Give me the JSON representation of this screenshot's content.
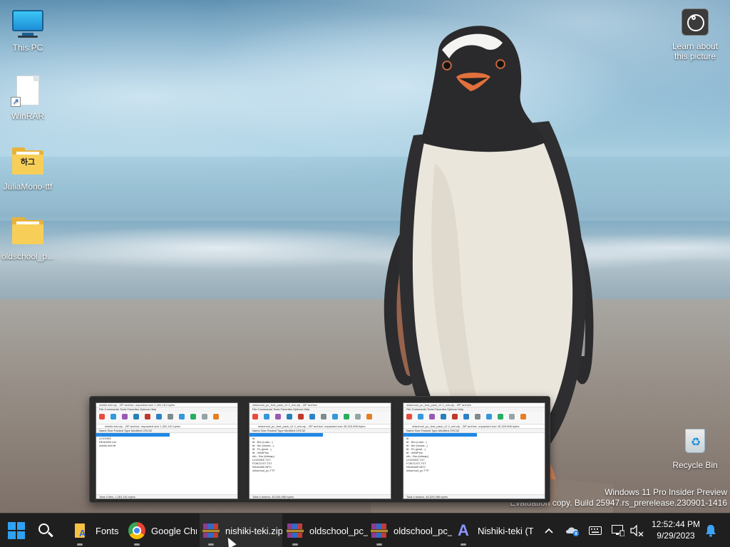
{
  "desktop": {
    "icons": [
      {
        "label": "This PC",
        "icon": "this-pc-icon"
      },
      {
        "label": "WinRAR",
        "icon": "winrar-shortcut-icon"
      },
      {
        "label": "JuliaMono-ttf",
        "icon": "folder-icon",
        "badge": "하그"
      },
      {
        "label": "oldschool_p...",
        "icon": "folder-icon"
      }
    ],
    "learn_about_picture": {
      "label_line1": "Learn about",
      "label_line2": "this picture",
      "icon": "camera-info-icon"
    },
    "recycle_bin": {
      "label": "Recycle Bin",
      "icon": "recycle-bin-icon"
    },
    "watermark": {
      "line1": "Windows 11 Pro Insider Preview",
      "line2": "Evaluation copy. Build 25947.rs_prerelease.230901-1416"
    }
  },
  "previews": [
    {
      "title": "nishiki-teki.zip - ZIP archive, unpacked size 1,281,161 bytes",
      "menu": "File  Commands  Tools  Favorites  Options  Help",
      "tools": [
        "Add",
        "Extract To",
        "Test",
        "View",
        "Delete",
        "Find",
        "Wizard",
        "Info",
        "VirusScan",
        "Comment",
        "SFX"
      ],
      "address": "nishiki-teki.zip - ZIP archive, unpacked size 1,281,161 bytes",
      "header": "Name          Size    Packed   Type         Modified      CRC32",
      "rows": [
        "..",
        "LICENSE",
        "README.md",
        "nishiki-teki.ttf"
      ],
      "status": "Total 3 files, 1,281,161 bytes"
    },
    {
      "title": "oldschool_pc_font_pack_v2.2_win.zip - ZIP archive",
      "menu": "File  Commands  Tools  Favorites  Options  Help",
      "tools": [
        "Add",
        "Extract To",
        "Test",
        "View",
        "Delete",
        "Find",
        "Wizard",
        "Info",
        "VirusScan",
        "Comment",
        "SFX"
      ],
      "address": "oldschool_pc_font_pack_v2.2_win.zip - ZIP archive, unpacked size 45,325,958 bytes",
      "header": "Name          Size    Packed   Type         Modified      CRC32",
      "rows": [
        "..",
        "ttf",
        "ttf - Bm (Latin...)",
        "ttf - Mx (mixed...)",
        "ttf - Px (pixel...)",
        "ttf - WebPlus",
        "otb - Bm (bitmap)",
        "LICENSE.TXT",
        "FONTLIST.TXT",
        "README.NFO",
        "oldschool_pc.TTF"
      ],
      "status": "Total 4 folders, 45,325,958 bytes"
    },
    {
      "title": "oldschool_pc_font_pack_v2.2_win.zip - ZIP archive",
      "menu": "File  Commands  Tools  Favorites  Options  Help",
      "tools": [
        "Add",
        "Extract To",
        "Test",
        "View",
        "Delete",
        "Find",
        "Wizard",
        "Info",
        "VirusScan",
        "Comment",
        "SFX"
      ],
      "address": "oldschool_pc_font_pack_v2.2_win.zip - ZIP archive, unpacked size 45,325,958 bytes",
      "header": "Name          Size    Packed   Type         Modified      CRC32",
      "rows": [
        "..",
        "ttf",
        "ttf - Bm (Latin...)",
        "ttf - Mx (mixed...)",
        "ttf - Px (pixel...)",
        "ttf - WebPlus",
        "otb - Bm (bitmap)",
        "LICENSE.TXT",
        "FONTLIST.TXT",
        "README.NFO",
        "oldschool_pc.TTF"
      ],
      "status": "Total 4 folders, 45,325,958 bytes"
    }
  ],
  "taskbar": {
    "start": {
      "icon": "windows-start-icon"
    },
    "search": {
      "icon": "search-icon"
    },
    "apps": [
      {
        "label": "Fonts",
        "icon": "fonts-folder-icon"
      },
      {
        "label": "Google Chr",
        "icon": "chrome-icon"
      },
      {
        "label": "nishiki-teki.zip",
        "icon": "winrar-icon"
      },
      {
        "label": "oldschool_pc_",
        "icon": "winrar-icon"
      },
      {
        "label": "oldschool_pc_",
        "icon": "winrar-icon"
      },
      {
        "label": "Nishiki-teki (T",
        "icon": "font-viewer-icon"
      }
    ],
    "tray": {
      "overflow_icon": "chevron-up-icon",
      "onedrive_icon": "onedrive-icon",
      "keyboard_icon": "keyboard-icon",
      "display_icon": "display-icon",
      "volume_icon": "volume-muted-icon",
      "time": "12:52:44 PM",
      "date": "9/29/2023",
      "notification_icon": "notification-bell-icon"
    }
  }
}
